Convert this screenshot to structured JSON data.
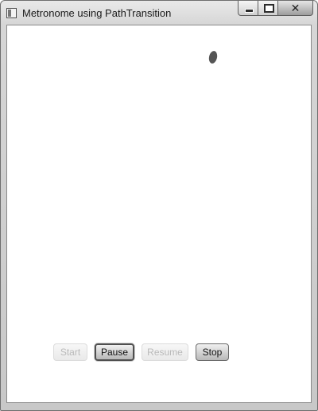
{
  "window": {
    "title": "Metronome using PathTransition",
    "controls": {
      "minimize": "minimize-icon",
      "maximize": "maximize-icon",
      "close": "close-icon",
      "close_glyph": "✕"
    }
  },
  "buttons": [
    {
      "label": "Start",
      "enabled": false
    },
    {
      "label": "Pause",
      "enabled": true,
      "focused": true
    },
    {
      "label": "Resume",
      "enabled": false
    },
    {
      "label": "Stop",
      "enabled": true
    }
  ],
  "colors": {
    "node": "#555555",
    "background": "#ffffff"
  }
}
